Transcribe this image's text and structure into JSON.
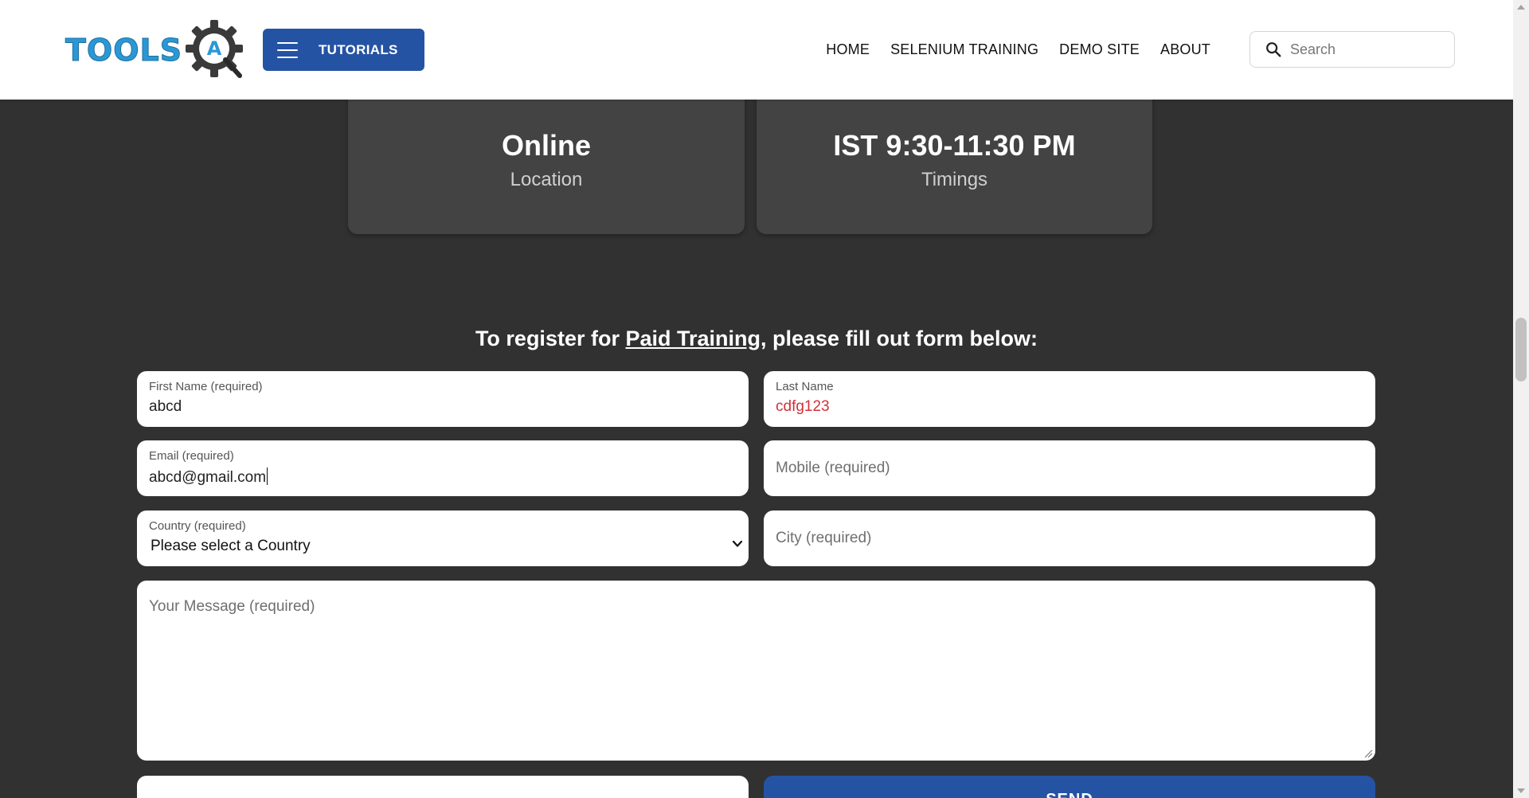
{
  "header": {
    "logo_text": "TOOLS",
    "logo_letter": "A",
    "tutorials_label": "TUTORIALS",
    "nav": [
      {
        "label": "HOME"
      },
      {
        "label": "SELENIUM TRAINING"
      },
      {
        "label": "DEMO SITE"
      },
      {
        "label": "ABOUT"
      }
    ],
    "search_placeholder": "Search"
  },
  "cards": [
    {
      "value": "Online",
      "label": "Location"
    },
    {
      "value": "IST 9:30-11:30 PM",
      "label": "Timings"
    }
  ],
  "form": {
    "title_prefix": "To register for ",
    "title_link": "Paid Training",
    "title_suffix": ", please fill out form below:",
    "first_name": {
      "label": "First Name (required)",
      "value": "abcd"
    },
    "last_name": {
      "label": "Last Name",
      "value": "cdfg123"
    },
    "email": {
      "label": "Email (required)",
      "value": "abcd@gmail.com"
    },
    "mobile": {
      "placeholder": "Mobile (required)"
    },
    "country": {
      "label": "Country (required)",
      "selected": "Please select a Country"
    },
    "city": {
      "placeholder": "City (required)"
    },
    "message": {
      "placeholder": "Your Message (required)"
    },
    "send_label": "SEND"
  },
  "colors": {
    "brand_blue": "#2553A4",
    "page_background": "#313131",
    "card_background": "#434343",
    "error_text": "#d0313a",
    "logo_blue": "#2A98D5"
  },
  "scroll": {
    "position_fraction": 0.43
  }
}
